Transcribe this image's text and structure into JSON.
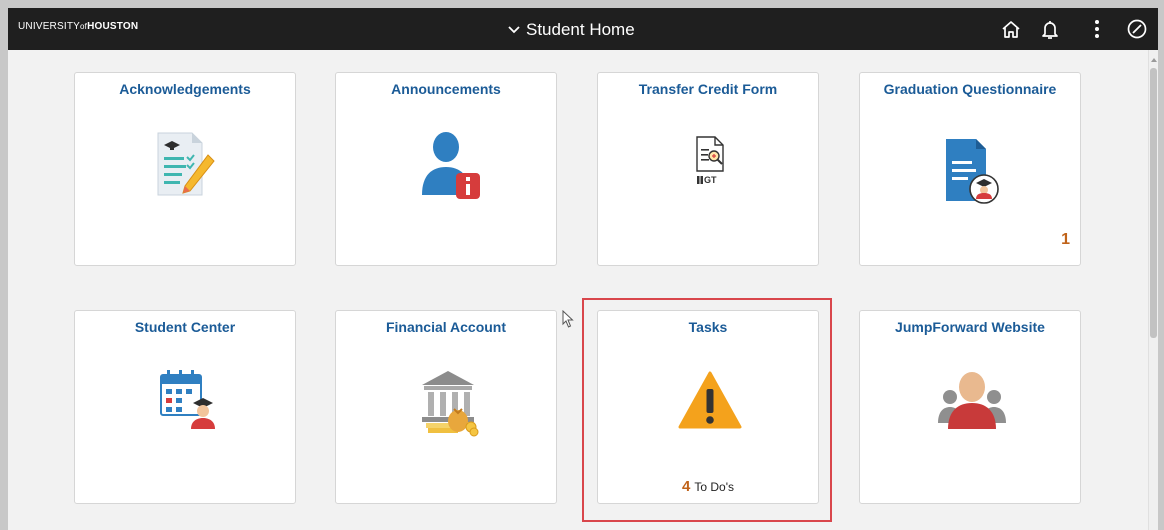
{
  "header": {
    "logo_part1": "UNIVERSITY",
    "logo_part2": "of",
    "logo_part3": "HOUSTON",
    "title": "Student Home",
    "icons": [
      "chevron-down-icon",
      "home-icon",
      "bell-icon",
      "more-vertical-icon",
      "compass-icon"
    ]
  },
  "tiles": [
    {
      "title": "Acknowledgements",
      "icon": "document-checklist-icon"
    },
    {
      "title": "Announcements",
      "icon": "user-info-icon"
    },
    {
      "title": "Transfer Credit Form",
      "icon": "document-search-icon",
      "icon_text": "GT"
    },
    {
      "title": "Graduation Questionnaire",
      "icon": "graduation-document-icon",
      "badge": "1"
    },
    {
      "title": "Student Center",
      "icon": "calendar-student-icon"
    },
    {
      "title": "Financial Account",
      "icon": "bank-money-icon"
    },
    {
      "title": "Tasks",
      "icon": "warning-icon",
      "todo_count": "4",
      "todo_label": "To Do's"
    },
    {
      "title": "JumpForward Website",
      "icon": "group-users-icon"
    }
  ],
  "colors": {
    "header_bg": "#1f1f1f",
    "tile_title": "#1b5b97",
    "badge": "#c0631a",
    "highlight": "#d9464c",
    "warning": "#f4a21c"
  }
}
